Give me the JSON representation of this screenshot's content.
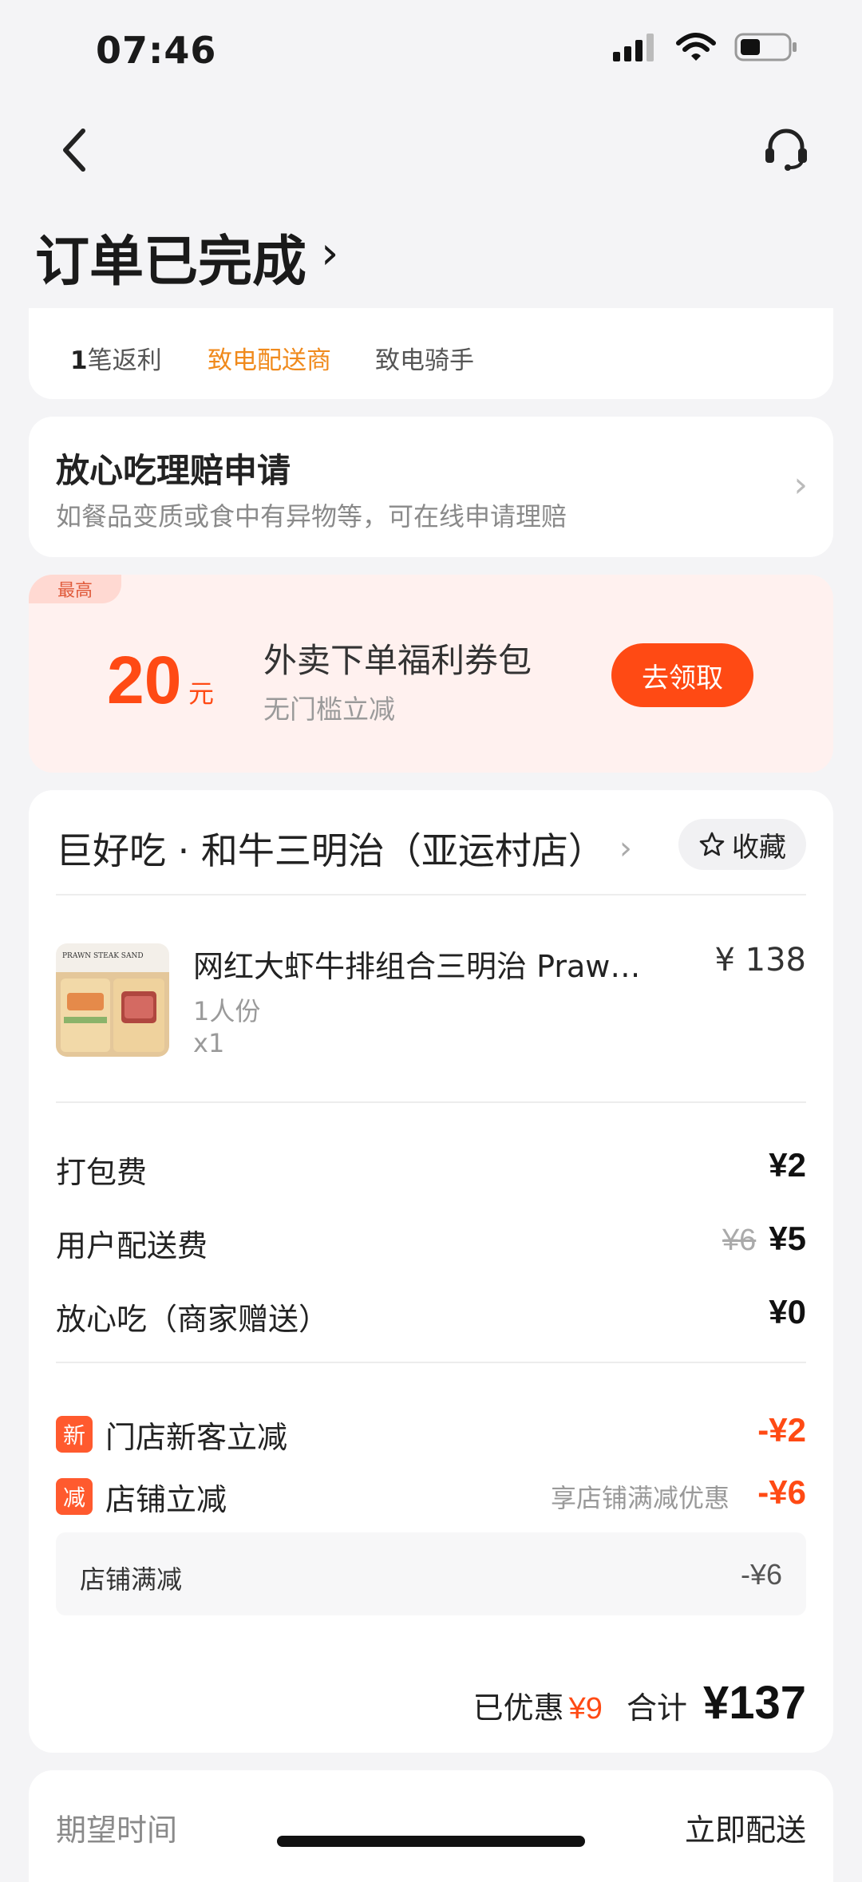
{
  "status_bar": {
    "time": "07:46"
  },
  "header": {
    "title": "订单已完成"
  },
  "actions": [
    {
      "prefix": "1",
      "label": "笔返利"
    },
    {
      "prefix": "",
      "label": "致电配送商"
    },
    {
      "prefix": "",
      "label": "致电骑手"
    }
  ],
  "claim": {
    "title": "放心吃理赔申请",
    "subtitle": "如餐品变质或食中有异物等，可在线申请理赔"
  },
  "coupon": {
    "tag": "最高",
    "amount": "20",
    "unit": "元",
    "title": "外卖下单福利券包",
    "subtitle": "无门槛立减",
    "button": "去领取"
  },
  "shop": {
    "name": "巨好吃 · 和牛三明治（亚运村店）",
    "favorite_label": "收藏"
  },
  "item": {
    "name": "网红大虾牛排组合三明治 Prawn s...",
    "price": "¥ 138",
    "spec": "1人份",
    "qty": "x1",
    "image_text": "PRAWN STEAK SAND"
  },
  "fees": [
    {
      "label": "打包费",
      "original": "",
      "value": "¥2"
    },
    {
      "label": "用户配送费",
      "original": "¥6",
      "value": "¥5"
    },
    {
      "label": "放心吃（商家赠送）",
      "original": "",
      "value": "¥0"
    }
  ],
  "discounts": [
    {
      "icon": "新",
      "label": "门店新客立减",
      "note": "",
      "value": "-¥2"
    },
    {
      "icon": "减",
      "label": "店铺立减",
      "note": "享店铺满减优惠",
      "value": "-¥6"
    }
  ],
  "sub_discount": {
    "label": "店铺满减",
    "value": "-¥6"
  },
  "total": {
    "saved_label": "已优惠",
    "saved_value": "¥9",
    "total_label": "合计",
    "total_value": "¥137"
  },
  "expect": {
    "label": "期望时间",
    "value": "立即配送"
  },
  "colors": {
    "accent": "#ff4a14",
    "orange": "#f08a1c",
    "background": "#f4f4f6"
  }
}
